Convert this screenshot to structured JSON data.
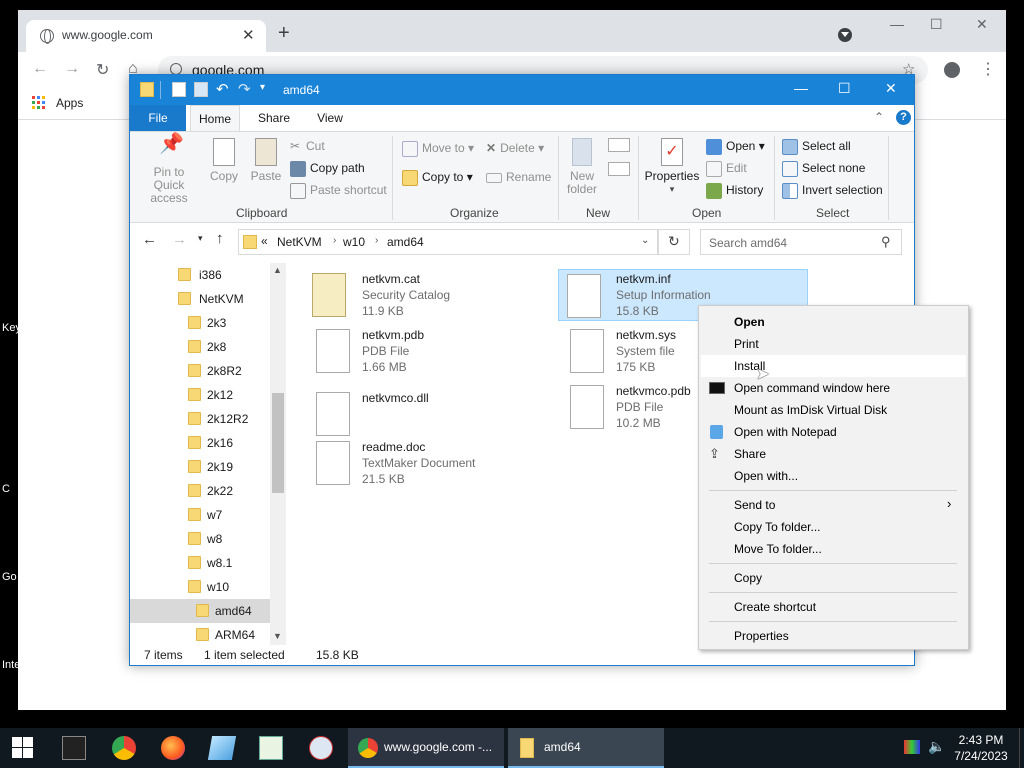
{
  "desktop": {
    "edge_labels": [
      "Key",
      "C",
      "Go",
      "Inte"
    ]
  },
  "chrome": {
    "tab_title": "www.google.com",
    "url": "google.com",
    "bookmarks": {
      "apps_label": "Apps"
    }
  },
  "explorer": {
    "title": "amd64",
    "tabs": {
      "file": "File",
      "home": "Home",
      "share": "Share",
      "view": "View"
    },
    "ribbon": {
      "clipboard": {
        "pin": "Pin to Quick access",
        "copy": "Copy",
        "paste": "Paste",
        "cut": "Cut",
        "copy_path": "Copy path",
        "paste_shortcut": "Paste shortcut",
        "group": "Clipboard"
      },
      "organize": {
        "move_to": "Move to",
        "copy_to": "Copy to",
        "delete": "Delete",
        "rename": "Rename",
        "group": "Organize"
      },
      "new": {
        "new_folder": "New folder",
        "group": "New"
      },
      "open": {
        "properties": "Properties",
        "open": "Open",
        "edit": "Edit",
        "history": "History",
        "group": "Open"
      },
      "select": {
        "select_all": "Select all",
        "select_none": "Select none",
        "invert": "Invert selection",
        "group": "Select"
      }
    },
    "address": {
      "prefix": "«",
      "crumbs": [
        "NetKVM",
        "w10",
        "amd64"
      ],
      "search_placeholder": "Search amd64"
    },
    "nav_tree": [
      "i386",
      "NetKVM",
      "2k3",
      "2k8",
      "2k8R2",
      "2k12",
      "2k12R2",
      "2k16",
      "2k19",
      "2k22",
      "w7",
      "w8",
      "w8.1",
      "w10",
      "amd64",
      "ARM64"
    ],
    "files": [
      {
        "name": "netkvm.cat",
        "type": "Security Catalog",
        "size": "11.9 KB"
      },
      {
        "name": "netkvm.inf",
        "type": "Setup Information",
        "size": "15.8 KB"
      },
      {
        "name": "netkvm.pdb",
        "type": "PDB File",
        "size": "1.66 MB"
      },
      {
        "name": "netkvm.sys",
        "type": "System file",
        "size": "175 KB"
      },
      {
        "name": "netkvmco.dll",
        "type": "",
        "size": ""
      },
      {
        "name": "netkvmco.pdb",
        "type": "PDB File",
        "size": "10.2 MB"
      },
      {
        "name": "readme.doc",
        "type": "TextMaker Document",
        "size": "21.5 KB"
      }
    ],
    "status": {
      "count": "7 items",
      "selected": "1 item selected",
      "size": "15.8 KB"
    }
  },
  "context_menu": {
    "items": [
      "Open",
      "Print",
      "Install",
      "Open command window here",
      "Mount as ImDisk Virtual Disk",
      "Open with Notepad",
      "Share",
      "Open with...",
      "Send to",
      "Copy To folder...",
      "Move To folder...",
      "Copy",
      "Create shortcut",
      "Properties"
    ]
  },
  "taskbar": {
    "chrome_window": "www.google.com -...",
    "explorer_window": "amd64",
    "time": "2:43 PM",
    "date": "7/24/2023"
  },
  "colors": {
    "accent": "#1983d8",
    "selection": "#cce8ff",
    "taskbar": "#101820"
  }
}
